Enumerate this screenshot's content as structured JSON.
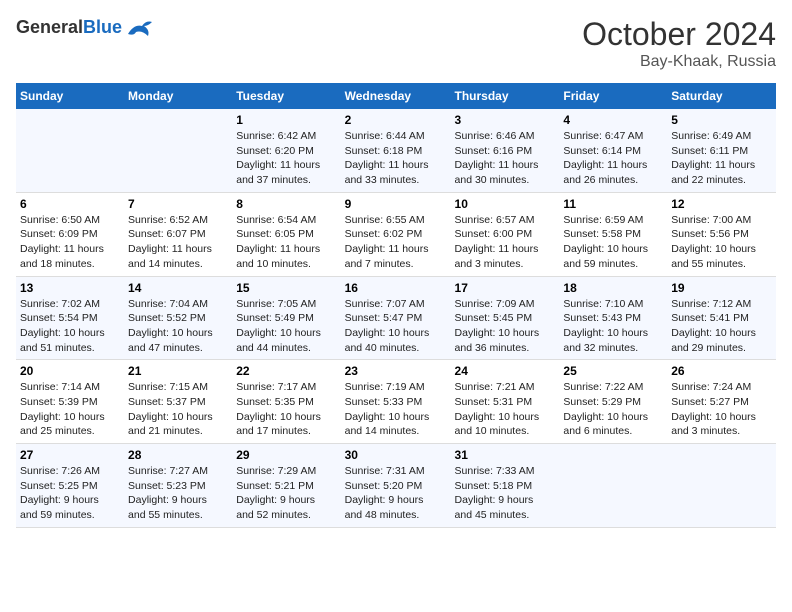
{
  "header": {
    "logo_general": "General",
    "logo_blue": "Blue",
    "month": "October 2024",
    "location": "Bay-Khaak, Russia"
  },
  "days_of_week": [
    "Sunday",
    "Monday",
    "Tuesday",
    "Wednesday",
    "Thursday",
    "Friday",
    "Saturday"
  ],
  "weeks": [
    [
      {
        "num": "",
        "info": ""
      },
      {
        "num": "",
        "info": ""
      },
      {
        "num": "1",
        "info": "Sunrise: 6:42 AM\nSunset: 6:20 PM\nDaylight: 11 hours\nand 37 minutes."
      },
      {
        "num": "2",
        "info": "Sunrise: 6:44 AM\nSunset: 6:18 PM\nDaylight: 11 hours\nand 33 minutes."
      },
      {
        "num": "3",
        "info": "Sunrise: 6:46 AM\nSunset: 6:16 PM\nDaylight: 11 hours\nand 30 minutes."
      },
      {
        "num": "4",
        "info": "Sunrise: 6:47 AM\nSunset: 6:14 PM\nDaylight: 11 hours\nand 26 minutes."
      },
      {
        "num": "5",
        "info": "Sunrise: 6:49 AM\nSunset: 6:11 PM\nDaylight: 11 hours\nand 22 minutes."
      }
    ],
    [
      {
        "num": "6",
        "info": "Sunrise: 6:50 AM\nSunset: 6:09 PM\nDaylight: 11 hours\nand 18 minutes."
      },
      {
        "num": "7",
        "info": "Sunrise: 6:52 AM\nSunset: 6:07 PM\nDaylight: 11 hours\nand 14 minutes."
      },
      {
        "num": "8",
        "info": "Sunrise: 6:54 AM\nSunset: 6:05 PM\nDaylight: 11 hours\nand 10 minutes."
      },
      {
        "num": "9",
        "info": "Sunrise: 6:55 AM\nSunset: 6:02 PM\nDaylight: 11 hours\nand 7 minutes."
      },
      {
        "num": "10",
        "info": "Sunrise: 6:57 AM\nSunset: 6:00 PM\nDaylight: 11 hours\nand 3 minutes."
      },
      {
        "num": "11",
        "info": "Sunrise: 6:59 AM\nSunset: 5:58 PM\nDaylight: 10 hours\nand 59 minutes."
      },
      {
        "num": "12",
        "info": "Sunrise: 7:00 AM\nSunset: 5:56 PM\nDaylight: 10 hours\nand 55 minutes."
      }
    ],
    [
      {
        "num": "13",
        "info": "Sunrise: 7:02 AM\nSunset: 5:54 PM\nDaylight: 10 hours\nand 51 minutes."
      },
      {
        "num": "14",
        "info": "Sunrise: 7:04 AM\nSunset: 5:52 PM\nDaylight: 10 hours\nand 47 minutes."
      },
      {
        "num": "15",
        "info": "Sunrise: 7:05 AM\nSunset: 5:49 PM\nDaylight: 10 hours\nand 44 minutes."
      },
      {
        "num": "16",
        "info": "Sunrise: 7:07 AM\nSunset: 5:47 PM\nDaylight: 10 hours\nand 40 minutes."
      },
      {
        "num": "17",
        "info": "Sunrise: 7:09 AM\nSunset: 5:45 PM\nDaylight: 10 hours\nand 36 minutes."
      },
      {
        "num": "18",
        "info": "Sunrise: 7:10 AM\nSunset: 5:43 PM\nDaylight: 10 hours\nand 32 minutes."
      },
      {
        "num": "19",
        "info": "Sunrise: 7:12 AM\nSunset: 5:41 PM\nDaylight: 10 hours\nand 29 minutes."
      }
    ],
    [
      {
        "num": "20",
        "info": "Sunrise: 7:14 AM\nSunset: 5:39 PM\nDaylight: 10 hours\nand 25 minutes."
      },
      {
        "num": "21",
        "info": "Sunrise: 7:15 AM\nSunset: 5:37 PM\nDaylight: 10 hours\nand 21 minutes."
      },
      {
        "num": "22",
        "info": "Sunrise: 7:17 AM\nSunset: 5:35 PM\nDaylight: 10 hours\nand 17 minutes."
      },
      {
        "num": "23",
        "info": "Sunrise: 7:19 AM\nSunset: 5:33 PM\nDaylight: 10 hours\nand 14 minutes."
      },
      {
        "num": "24",
        "info": "Sunrise: 7:21 AM\nSunset: 5:31 PM\nDaylight: 10 hours\nand 10 minutes."
      },
      {
        "num": "25",
        "info": "Sunrise: 7:22 AM\nSunset: 5:29 PM\nDaylight: 10 hours\nand 6 minutes."
      },
      {
        "num": "26",
        "info": "Sunrise: 7:24 AM\nSunset: 5:27 PM\nDaylight: 10 hours\nand 3 minutes."
      }
    ],
    [
      {
        "num": "27",
        "info": "Sunrise: 7:26 AM\nSunset: 5:25 PM\nDaylight: 9 hours\nand 59 minutes."
      },
      {
        "num": "28",
        "info": "Sunrise: 7:27 AM\nSunset: 5:23 PM\nDaylight: 9 hours\nand 55 minutes."
      },
      {
        "num": "29",
        "info": "Sunrise: 7:29 AM\nSunset: 5:21 PM\nDaylight: 9 hours\nand 52 minutes."
      },
      {
        "num": "30",
        "info": "Sunrise: 7:31 AM\nSunset: 5:20 PM\nDaylight: 9 hours\nand 48 minutes."
      },
      {
        "num": "31",
        "info": "Sunrise: 7:33 AM\nSunset: 5:18 PM\nDaylight: 9 hours\nand 45 minutes."
      },
      {
        "num": "",
        "info": ""
      },
      {
        "num": "",
        "info": ""
      }
    ]
  ]
}
